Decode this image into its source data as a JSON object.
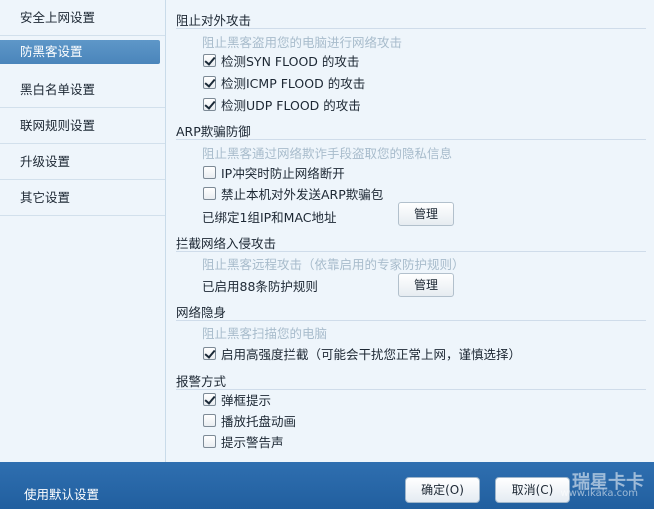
{
  "sidebar": {
    "items": [
      {
        "label": "安全上网设置"
      },
      {
        "label": "防黑客设置"
      },
      {
        "label": "黑白名单设置"
      },
      {
        "label": "联网规则设置"
      },
      {
        "label": "升级设置"
      },
      {
        "label": "其它设置"
      }
    ],
    "active_index": 1
  },
  "sections": {
    "block_attack": {
      "title": "阻止对外攻击",
      "hint": "阻止黑客盗用您的电脑进行网络攻击",
      "options": [
        {
          "label": "检测SYN  FLOOD 的攻击",
          "checked": true
        },
        {
          "label": "检测ICMP  FLOOD 的攻击",
          "checked": true
        },
        {
          "label": "检测UDP  FLOOD 的攻击",
          "checked": true
        }
      ]
    },
    "arp": {
      "title": "ARP欺骗防御",
      "hint": "阻止黑客通过网络欺诈手段盗取您的隐私信息",
      "options": [
        {
          "label": "IP冲突时防止网络断开",
          "checked": false
        },
        {
          "label": "禁止本机对外发送ARP欺骗包",
          "checked": false
        }
      ],
      "bound_text": "已绑定1组IP和MAC地址",
      "manage_label": "管理"
    },
    "intrusion": {
      "title": "拦截网络入侵攻击",
      "hint": "阻止黑客远程攻击（依靠启用的专家防护规则）",
      "rules_text": "已启用88条防护规则",
      "manage_label": "管理"
    },
    "stealth": {
      "title": "网络隐身",
      "hint": "阻止黑客扫描您的电脑",
      "options": [
        {
          "label": "启用高强度拦截（可能会干扰您正常上网，谨慎选择）",
          "checked": true
        }
      ]
    },
    "alarm": {
      "title": "报警方式",
      "options": [
        {
          "label": "弹框提示",
          "checked": true
        },
        {
          "label": "播放托盘动画",
          "checked": false
        },
        {
          "label": "提示警告声",
          "checked": false
        }
      ]
    }
  },
  "footer": {
    "default_link": "使用默认设置",
    "ok_label": "确定(O)",
    "cancel_label": "取消(C)",
    "watermark_main": "瑞星卡卡",
    "watermark_url": "www.ikaka.com"
  }
}
